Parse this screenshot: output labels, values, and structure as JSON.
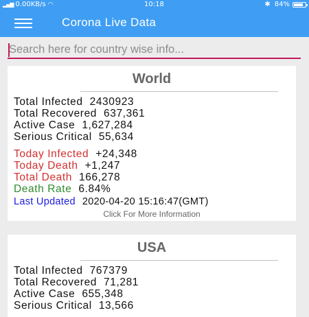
{
  "status_bar": {
    "network_speed": "0.00KB/s",
    "time": "10:18",
    "battery_percent": "84%",
    "battery_level": 0.84,
    "icons": [
      "signal-icon",
      "wifi-icon",
      "bluetooth-icon",
      "battery-icon"
    ]
  },
  "app_bar": {
    "title": "Corona Live Data",
    "menu_icon": "hamburger-menu-icon",
    "color": "#3f9ef3"
  },
  "search": {
    "placeholder": "Search here for country wise info...",
    "value": "",
    "underline_color": "#c2185b"
  },
  "world": {
    "heading": "World",
    "stats": [
      {
        "label": "Total Infected",
        "value": "2430923"
      },
      {
        "label": "Total Recovered",
        "value": "637,361"
      },
      {
        "label": "Active Case",
        "value": "1,627,284"
      },
      {
        "label": "Serious Critical",
        "value": "55,634"
      }
    ],
    "today": [
      {
        "label": "Today Infected",
        "value": "+24,348",
        "color": "#d32f2f"
      },
      {
        "label": "Today Death",
        "value": "+1,247",
        "color": "#d32f2f"
      },
      {
        "label": "Total Death",
        "value": "166,278",
        "color": "#d32f2f"
      },
      {
        "label": "Death Rate",
        "value": "6.84%",
        "color": "#2e8b2e"
      }
    ],
    "last_updated_label": "Last Updated",
    "last_updated_value": "2020-04-20 15:16:47(GMT)",
    "more_link": "Click For More Information"
  },
  "usa": {
    "heading": "USA",
    "stats": [
      {
        "label": "Total Infected",
        "value": "767379"
      },
      {
        "label": "Total Recovered",
        "value": "71,281"
      },
      {
        "label": "Active Case",
        "value": "655,348"
      },
      {
        "label": "Serious Critical",
        "value": "13,566"
      }
    ]
  }
}
